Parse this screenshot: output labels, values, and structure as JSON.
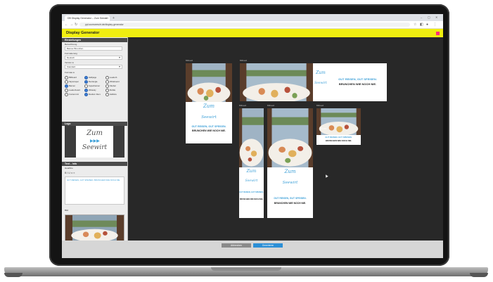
{
  "browser": {
    "tab_title": "DB Display Generator – Zum Seewirt",
    "url": "ppt.zumseewirt.de/display-generator"
  },
  "app": {
    "title": "Display Generator"
  },
  "panel": {
    "settings_header": "Einstellungen",
    "field1_label": "Bezeichnung",
    "field1_value": "Banner Brunchen",
    "field2_label": "Formatierung",
    "field2_value": "Deutsch",
    "field3_label": "Version",
    "field3_value": "Standard",
    "formats_label": "Formate",
    "formats": [
      {
        "label": "Billboard",
        "on": false
      },
      {
        "label": "Halfpage",
        "on": true
      },
      {
        "label": "Leaderb.",
        "on": false
      },
      {
        "label": "Skyscraper",
        "on": false
      },
      {
        "label": "Rectangle",
        "on": true
      },
      {
        "label": "Wideboard",
        "on": false
      },
      {
        "label": "Banner",
        "on": true
      },
      {
        "label": "Superbanner",
        "on": false
      },
      {
        "label": "Sitebar",
        "on": false
      },
      {
        "label": "Leaderboard",
        "on": false
      },
      {
        "label": "Widesky",
        "on": true
      },
      {
        "label": "Mobile",
        "on": false
      },
      {
        "label": "Content Ad",
        "on": false
      },
      {
        "label": "Medium Rect.",
        "on": true
      },
      {
        "label": "Halfsize",
        "on": false
      }
    ],
    "logo_header": "Logo",
    "text_header": "Text – Info",
    "text_label": "Headline",
    "text_preview": "GUT REISEN, GUT SPEISEN. BRUNCHEN WIE NOCH NIE.",
    "image_label": "Bild"
  },
  "brand": {
    "line1": "Zum",
    "line2": "Seewirt"
  },
  "ads": {
    "label": "Billboard",
    "headline1": "GUT REISEN, GUT SPEISEN.",
    "headline2": "BRUNCHEN WIE NOCH NIE."
  },
  "buttons": {
    "cancel": "Abbrechen",
    "generate": "Generieren"
  },
  "colors": {
    "accent_yellow": "#f0ee10",
    "brand_blue": "#3da0d8",
    "dark_bg": "#282828"
  }
}
